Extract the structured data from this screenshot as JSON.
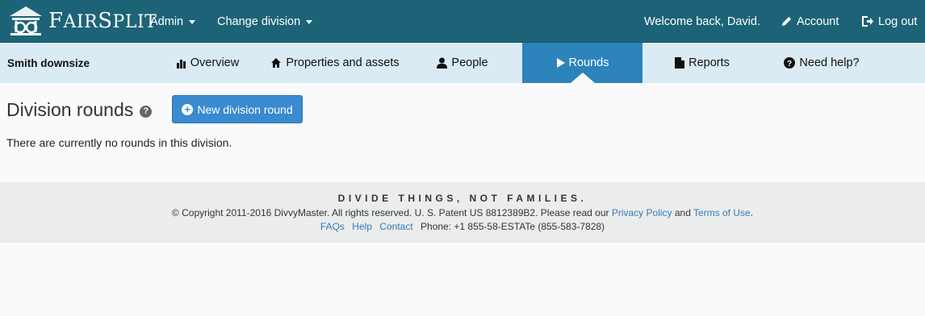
{
  "brand": {
    "name_first": "F",
    "name_rest1": "AIR",
    "name_second": "S",
    "name_rest2": "PLIT"
  },
  "topnav": {
    "admin_label": "Admin",
    "change_division_label": "Change division",
    "welcome_text": "Welcome back, David.",
    "account_label": "Account",
    "logout_label": "Log out"
  },
  "subnav": {
    "project_name": "Smith downsize",
    "tabs": [
      {
        "label": "Overview",
        "icon": "bar-chart-icon"
      },
      {
        "label": "Properties and assets",
        "icon": "home-icon"
      },
      {
        "label": "People",
        "icon": "user-icon"
      },
      {
        "label": "Rounds",
        "icon": "play-icon",
        "active": true
      },
      {
        "label": "Reports",
        "icon": "document-icon"
      },
      {
        "label": "Need help?",
        "icon": "question-circle-icon"
      }
    ]
  },
  "main": {
    "title": "Division rounds",
    "new_round_label": "New division round",
    "empty_message": "There are currently no rounds in this division."
  },
  "footer": {
    "tagline": "DIVIDE THINGS, NOT FAMILIES.",
    "copyright_text": "© Copyright 2011-2016 DivvyMaster.  All rights reserved.  U. S. Patent US 8812389B2.  Please read our",
    "privacy_label": "Privacy Policy",
    "and_text": "and",
    "terms_label": "Terms of Use",
    "period": ".",
    "faqs_label": "FAQs",
    "help_label": "Help",
    "contact_label": "Contact",
    "phone_text": "Phone: +1 855-58-ESTATe (855-583-7828)"
  },
  "colors": {
    "topbar": "#1d6378",
    "subbar": "#dbebf3",
    "active_tab": "#2c84ba",
    "primary_button": "#3a8ad0",
    "link": "#337ab7",
    "footer": "#ebeded"
  }
}
